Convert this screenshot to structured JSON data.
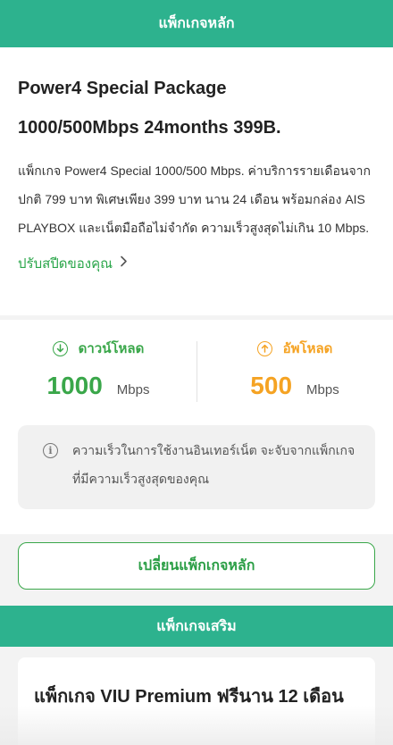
{
  "colors": {
    "accent_green": "#2db28e",
    "download_green": "#3aa74a",
    "upload_orange": "#f5a323"
  },
  "header": {
    "title": "แพ็กเกจหลัก"
  },
  "main_package": {
    "title_line1": "Power4 Special Package",
    "title_line2": "1000/500Mbps 24months 399B.",
    "description": "แพ็กเกจ Power4 Special 1000/500 Mbps. ค่าบริการรายเดือนจากปกติ 799 บาท พิเศษเพียง 399 บาท นาน 24 เดือน พร้อมกล่อง AIS PLAYBOX และเน็ตมือถือไม่จำกัด ความเร็วสูงสุดไม่เกิน 10 Mbps.",
    "adjust_link": "ปรับสปีดของคุณ",
    "adjust_icon": "chevron-right-icon"
  },
  "speed": {
    "download": {
      "label": "ดาวน์โหลด",
      "value": "1000",
      "unit": "Mbps",
      "icon": "download-arrow-icon"
    },
    "upload": {
      "label": "อัพโหลด",
      "value": "500",
      "unit": "Mbps",
      "icon": "upload-arrow-icon"
    }
  },
  "info": {
    "icon": "info-icon",
    "text": "ความเร็วในการใช้งานอินเทอร์เน็ต จะจับจากแพ็กเกจที่มีความเร็วสูงสุดของคุณ"
  },
  "change_button": {
    "label": "เปลี่ยนแพ็กเกจหลัก"
  },
  "addon_header": {
    "title": "แพ็กเกจเสริม"
  },
  "addon": {
    "title": "แพ็กเกจ VIU Premium ฟรีนาน 12 เดือน"
  }
}
